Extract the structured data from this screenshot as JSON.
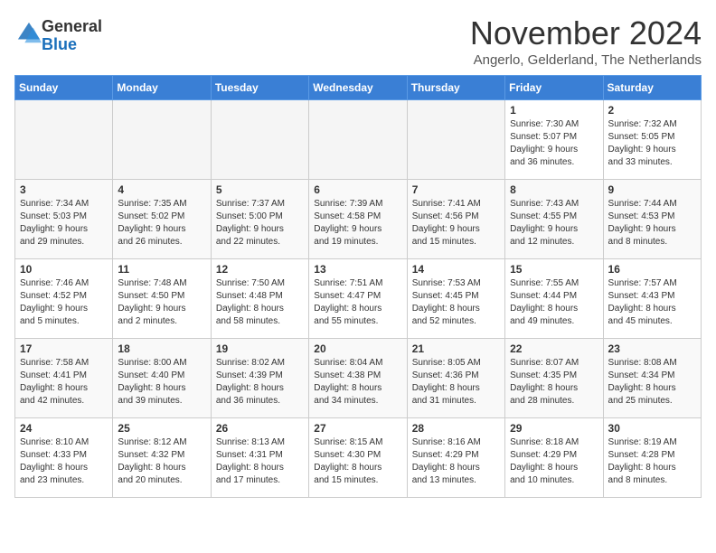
{
  "logo": {
    "general": "General",
    "blue": "Blue"
  },
  "title": "November 2024",
  "subtitle": "Angerlo, Gelderland, The Netherlands",
  "headers": [
    "Sunday",
    "Monday",
    "Tuesday",
    "Wednesday",
    "Thursday",
    "Friday",
    "Saturday"
  ],
  "weeks": [
    [
      {
        "day": "",
        "info": ""
      },
      {
        "day": "",
        "info": ""
      },
      {
        "day": "",
        "info": ""
      },
      {
        "day": "",
        "info": ""
      },
      {
        "day": "",
        "info": ""
      },
      {
        "day": "1",
        "info": "Sunrise: 7:30 AM\nSunset: 5:07 PM\nDaylight: 9 hours\nand 36 minutes."
      },
      {
        "day": "2",
        "info": "Sunrise: 7:32 AM\nSunset: 5:05 PM\nDaylight: 9 hours\nand 33 minutes."
      }
    ],
    [
      {
        "day": "3",
        "info": "Sunrise: 7:34 AM\nSunset: 5:03 PM\nDaylight: 9 hours\nand 29 minutes."
      },
      {
        "day": "4",
        "info": "Sunrise: 7:35 AM\nSunset: 5:02 PM\nDaylight: 9 hours\nand 26 minutes."
      },
      {
        "day": "5",
        "info": "Sunrise: 7:37 AM\nSunset: 5:00 PM\nDaylight: 9 hours\nand 22 minutes."
      },
      {
        "day": "6",
        "info": "Sunrise: 7:39 AM\nSunset: 4:58 PM\nDaylight: 9 hours\nand 19 minutes."
      },
      {
        "day": "7",
        "info": "Sunrise: 7:41 AM\nSunset: 4:56 PM\nDaylight: 9 hours\nand 15 minutes."
      },
      {
        "day": "8",
        "info": "Sunrise: 7:43 AM\nSunset: 4:55 PM\nDaylight: 9 hours\nand 12 minutes."
      },
      {
        "day": "9",
        "info": "Sunrise: 7:44 AM\nSunset: 4:53 PM\nDaylight: 9 hours\nand 8 minutes."
      }
    ],
    [
      {
        "day": "10",
        "info": "Sunrise: 7:46 AM\nSunset: 4:52 PM\nDaylight: 9 hours\nand 5 minutes."
      },
      {
        "day": "11",
        "info": "Sunrise: 7:48 AM\nSunset: 4:50 PM\nDaylight: 9 hours\nand 2 minutes."
      },
      {
        "day": "12",
        "info": "Sunrise: 7:50 AM\nSunset: 4:48 PM\nDaylight: 8 hours\nand 58 minutes."
      },
      {
        "day": "13",
        "info": "Sunrise: 7:51 AM\nSunset: 4:47 PM\nDaylight: 8 hours\nand 55 minutes."
      },
      {
        "day": "14",
        "info": "Sunrise: 7:53 AM\nSunset: 4:45 PM\nDaylight: 8 hours\nand 52 minutes."
      },
      {
        "day": "15",
        "info": "Sunrise: 7:55 AM\nSunset: 4:44 PM\nDaylight: 8 hours\nand 49 minutes."
      },
      {
        "day": "16",
        "info": "Sunrise: 7:57 AM\nSunset: 4:43 PM\nDaylight: 8 hours\nand 45 minutes."
      }
    ],
    [
      {
        "day": "17",
        "info": "Sunrise: 7:58 AM\nSunset: 4:41 PM\nDaylight: 8 hours\nand 42 minutes."
      },
      {
        "day": "18",
        "info": "Sunrise: 8:00 AM\nSunset: 4:40 PM\nDaylight: 8 hours\nand 39 minutes."
      },
      {
        "day": "19",
        "info": "Sunrise: 8:02 AM\nSunset: 4:39 PM\nDaylight: 8 hours\nand 36 minutes."
      },
      {
        "day": "20",
        "info": "Sunrise: 8:04 AM\nSunset: 4:38 PM\nDaylight: 8 hours\nand 34 minutes."
      },
      {
        "day": "21",
        "info": "Sunrise: 8:05 AM\nSunset: 4:36 PM\nDaylight: 8 hours\nand 31 minutes."
      },
      {
        "day": "22",
        "info": "Sunrise: 8:07 AM\nSunset: 4:35 PM\nDaylight: 8 hours\nand 28 minutes."
      },
      {
        "day": "23",
        "info": "Sunrise: 8:08 AM\nSunset: 4:34 PM\nDaylight: 8 hours\nand 25 minutes."
      }
    ],
    [
      {
        "day": "24",
        "info": "Sunrise: 8:10 AM\nSunset: 4:33 PM\nDaylight: 8 hours\nand 23 minutes."
      },
      {
        "day": "25",
        "info": "Sunrise: 8:12 AM\nSunset: 4:32 PM\nDaylight: 8 hours\nand 20 minutes."
      },
      {
        "day": "26",
        "info": "Sunrise: 8:13 AM\nSunset: 4:31 PM\nDaylight: 8 hours\nand 17 minutes."
      },
      {
        "day": "27",
        "info": "Sunrise: 8:15 AM\nSunset: 4:30 PM\nDaylight: 8 hours\nand 15 minutes."
      },
      {
        "day": "28",
        "info": "Sunrise: 8:16 AM\nSunset: 4:29 PM\nDaylight: 8 hours\nand 13 minutes."
      },
      {
        "day": "29",
        "info": "Sunrise: 8:18 AM\nSunset: 4:29 PM\nDaylight: 8 hours\nand 10 minutes."
      },
      {
        "day": "30",
        "info": "Sunrise: 8:19 AM\nSunset: 4:28 PM\nDaylight: 8 hours\nand 8 minutes."
      }
    ]
  ]
}
